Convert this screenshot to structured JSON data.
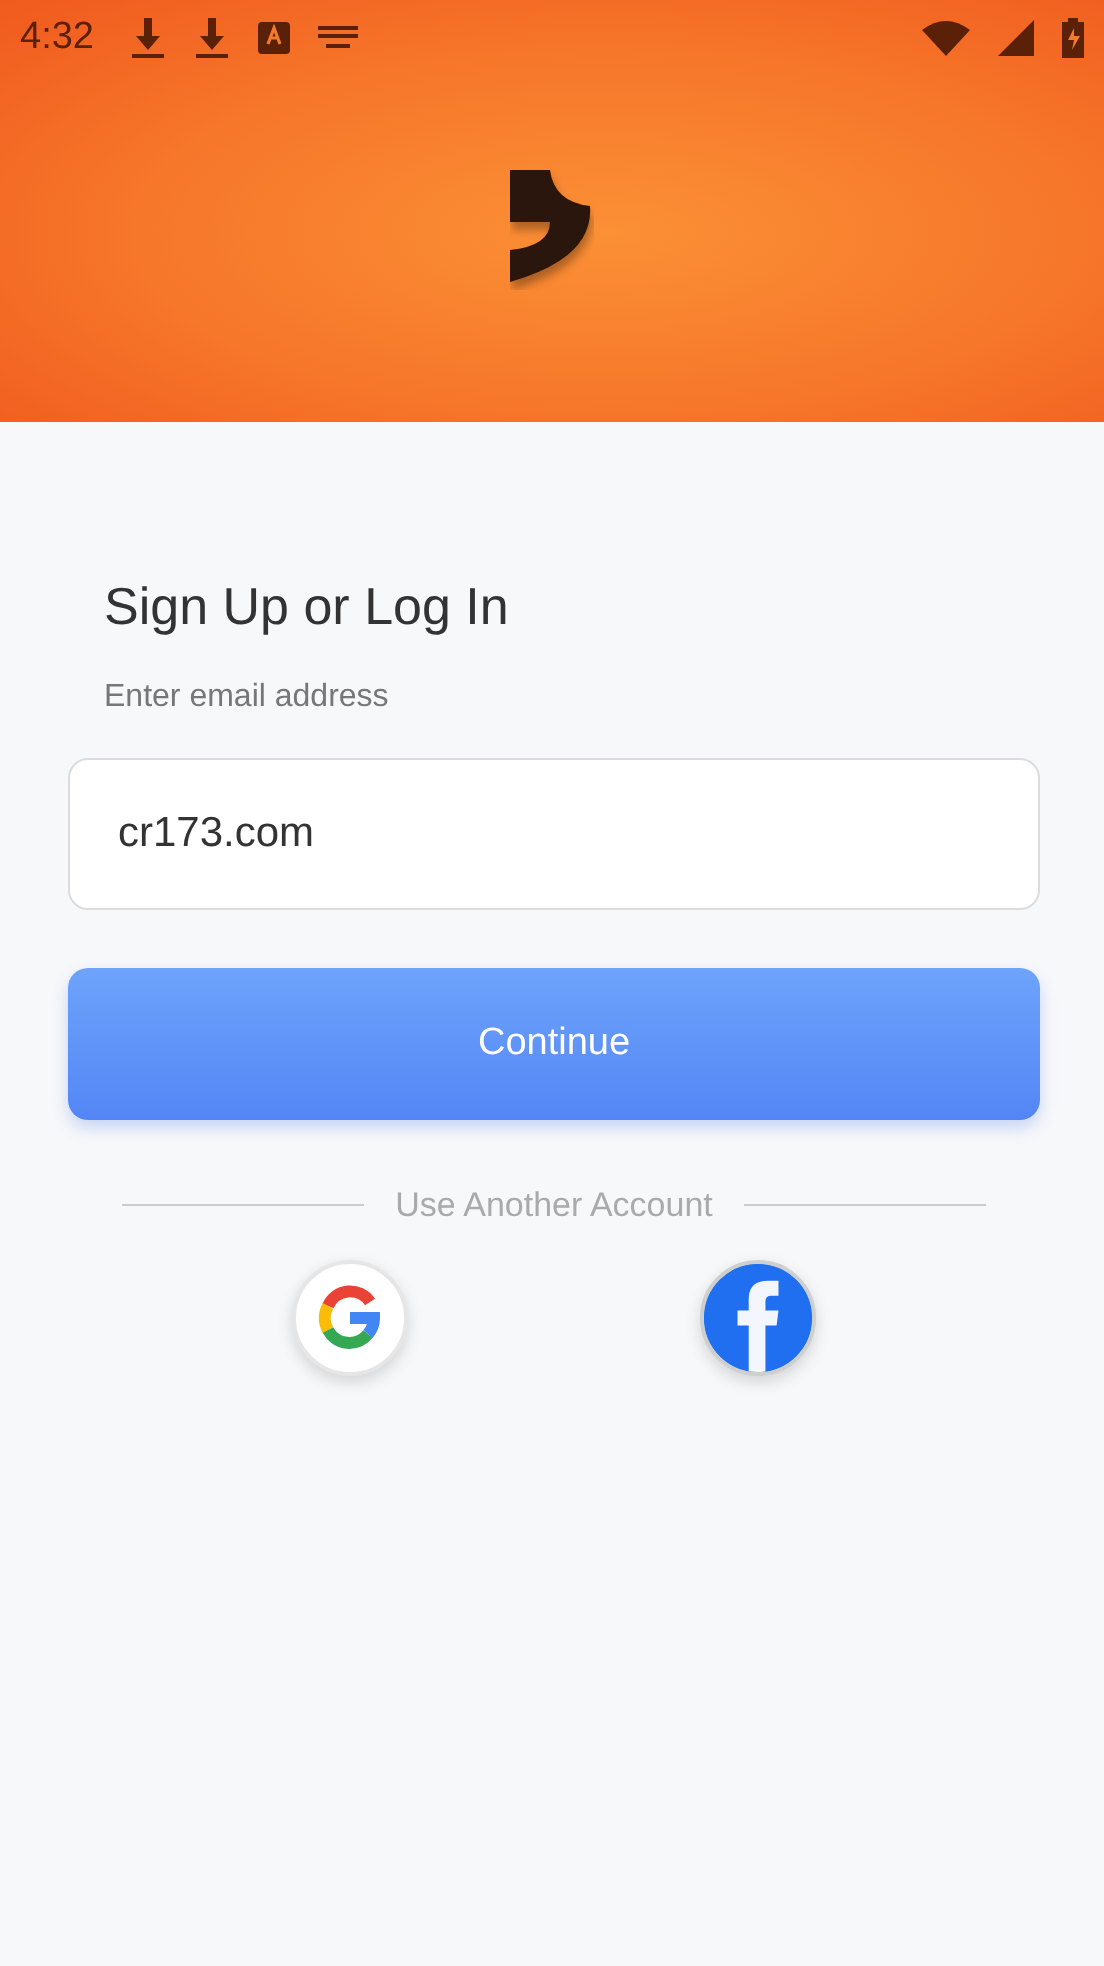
{
  "status_bar": {
    "time": "4:32"
  },
  "title": "Sign Up or Log In",
  "email_field": {
    "label": "Enter email address",
    "value": "cr173.com"
  },
  "continue_button": "Continue",
  "divider_text": "Use Another Account",
  "social_buttons": [
    {
      "kind": "google"
    },
    {
      "kind": "facebook"
    }
  ]
}
